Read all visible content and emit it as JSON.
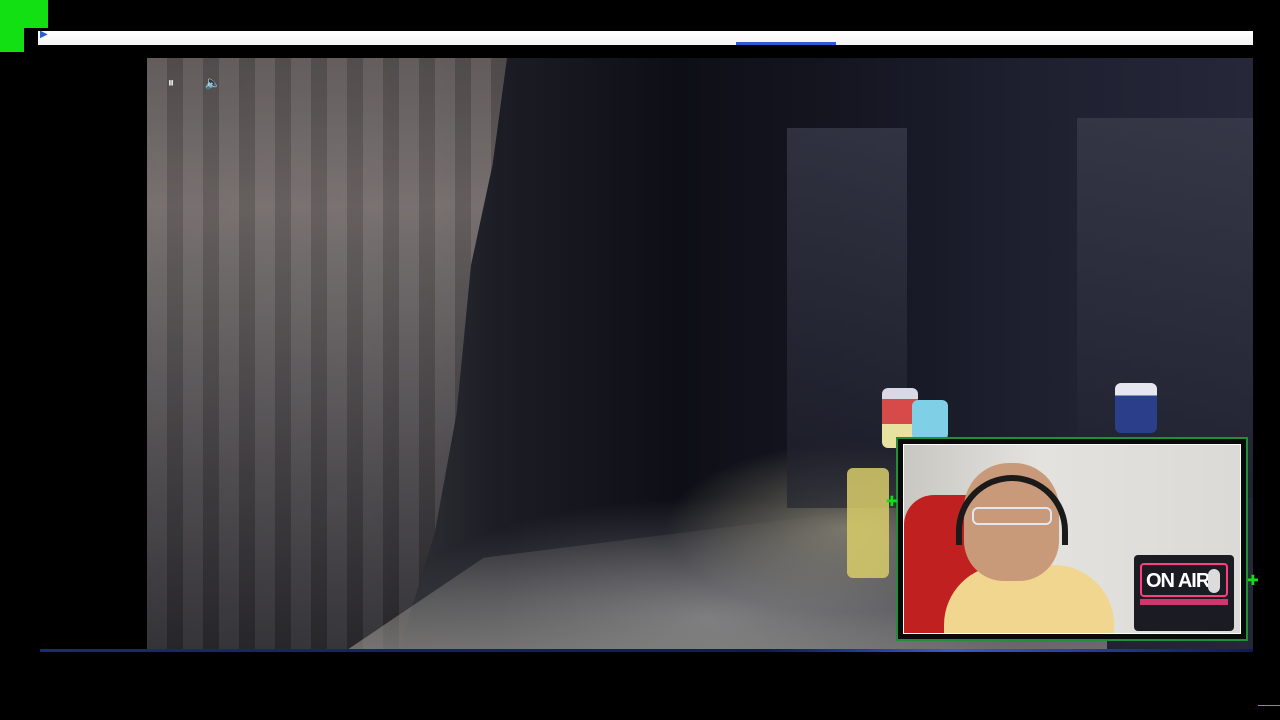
{
  "player": {
    "pause_icon": "⏸",
    "volume_icon": "🔈"
  },
  "webcam": {
    "sign_text": "ON AIR",
    "sign_mic_icon": "microphone-icon"
  },
  "colors": {
    "accent_green": "#12e012",
    "frame_green": "#1f8f3a",
    "sign_pink": "#ff3d7f",
    "strip_blue": "#2b5bd6"
  }
}
